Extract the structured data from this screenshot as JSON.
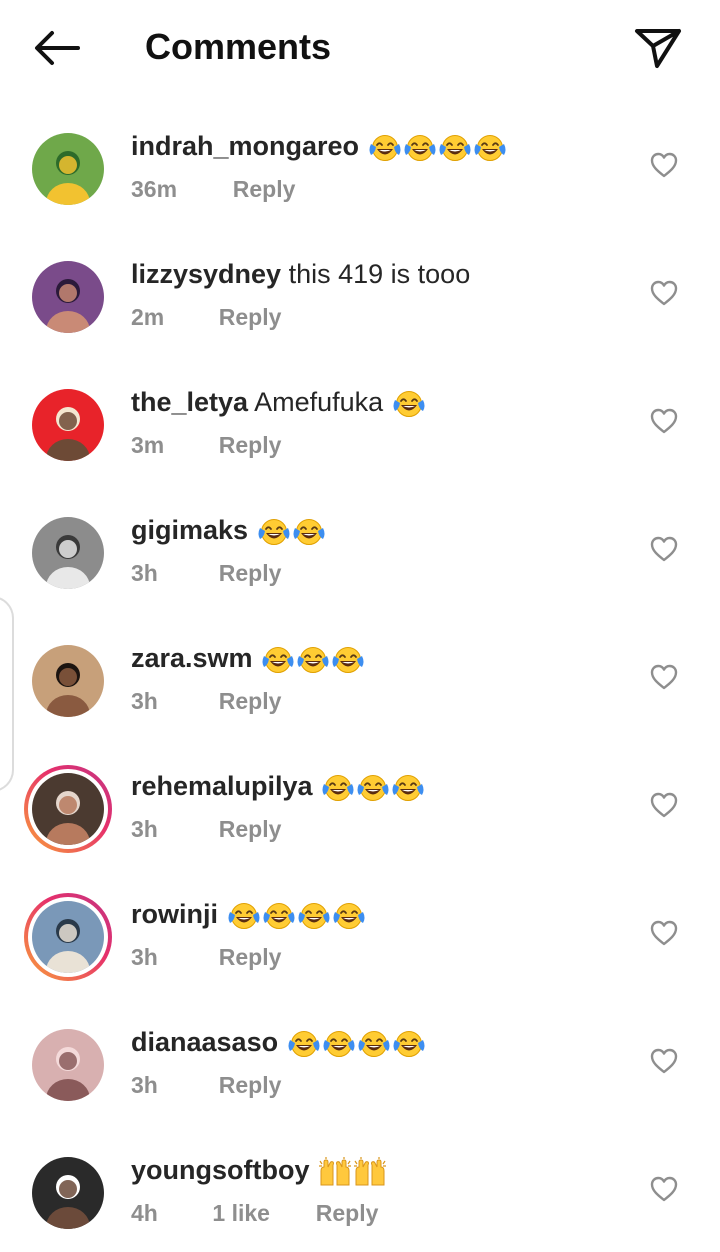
{
  "header": {
    "title": "Comments"
  },
  "icons": {
    "back": "arrow-left-icon",
    "share": "send-paper-plane-icon",
    "like": "heart-outline-icon",
    "laugh": "face-with-tears-of-joy-emoji",
    "raised_hands": "raising-hands-emoji"
  },
  "colors": {
    "text": "#262626",
    "meta": "#8e8e8e",
    "story_ring_start": "#f9a13a",
    "story_ring_end": "#c13584"
  },
  "comments": [
    {
      "username": "indrah_mongareo",
      "text": "",
      "emoji": [
        "laugh",
        "laugh",
        "laugh",
        "laugh"
      ],
      "time": "36m",
      "likes": "",
      "reply": "Reply",
      "story": false
    },
    {
      "username": "lizzysydney",
      "text": "this 419 is tooo",
      "emoji": [],
      "time": "2m",
      "likes": "",
      "reply": "Reply",
      "story": false
    },
    {
      "username": "the_letya",
      "text": "Amefufuka",
      "emoji": [
        "laugh"
      ],
      "time": "3m",
      "likes": "",
      "reply": "Reply",
      "story": false
    },
    {
      "username": "gigimaks",
      "text": "",
      "emoji": [
        "laugh",
        "laugh"
      ],
      "time": "3h",
      "likes": "",
      "reply": "Reply",
      "story": false
    },
    {
      "username": "zara.swm",
      "text": "",
      "emoji": [
        "laugh",
        "laugh",
        "laugh"
      ],
      "time": "3h",
      "likes": "",
      "reply": "Reply",
      "story": false
    },
    {
      "username": "rehemalupilya",
      "text": "",
      "emoji": [
        "laugh",
        "laugh",
        "laugh"
      ],
      "time": "3h",
      "likes": "",
      "reply": "Reply",
      "story": true
    },
    {
      "username": "rowinji",
      "text": "",
      "emoji": [
        "laugh",
        "laugh",
        "laugh",
        "laugh"
      ],
      "time": "3h",
      "likes": "",
      "reply": "Reply",
      "story": true
    },
    {
      "username": "dianaasaso",
      "text": "",
      "emoji": [
        "laugh",
        "laugh",
        "laugh",
        "laugh"
      ],
      "time": "3h",
      "likes": "",
      "reply": "Reply",
      "story": false
    },
    {
      "username": "youngsoftboy",
      "text": "",
      "emoji": [
        "raised_hands",
        "raised_hands"
      ],
      "time": "4h",
      "likes": "1 like",
      "reply": "Reply",
      "story": false
    }
  ]
}
